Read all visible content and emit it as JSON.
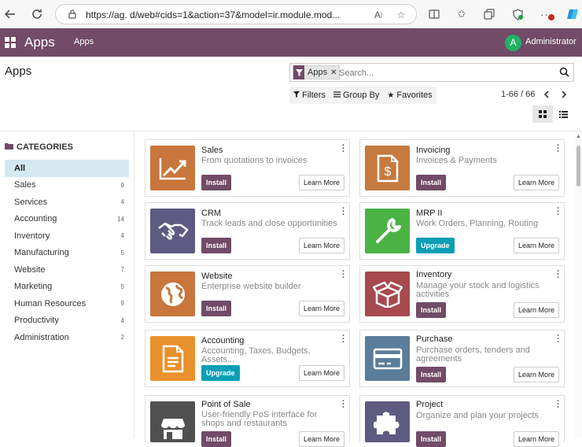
{
  "browser": {
    "url": "https://ag.          d/web#cids=1&action=37&model=ir.module.mod..."
  },
  "navbar": {
    "brand": "Apps",
    "menu_item": "Apps",
    "avatar_letter": "A",
    "user": "Administrator"
  },
  "control": {
    "title": "Apps",
    "facet_label": "Apps",
    "search_placeholder": "Search...",
    "filters": "Filters",
    "group_by": "Group By",
    "favorites": "Favorites",
    "pager": "1-66 / 66"
  },
  "sidebar": {
    "header": "CATEGORIES",
    "items": [
      {
        "label": "All",
        "count": ""
      },
      {
        "label": "Sales",
        "count": "9"
      },
      {
        "label": "Services",
        "count": "4"
      },
      {
        "label": "Accounting",
        "count": "14"
      },
      {
        "label": "Inventory",
        "count": "4"
      },
      {
        "label": "Manufacturing",
        "count": "5"
      },
      {
        "label": "Website",
        "count": "7"
      },
      {
        "label": "Marketing",
        "count": "5"
      },
      {
        "label": "Human Resources",
        "count": "9"
      },
      {
        "label": "Productivity",
        "count": "4"
      },
      {
        "label": "Administration",
        "count": "2"
      }
    ]
  },
  "apps": [
    {
      "name": "Sales",
      "summary": "From quotations to invoices",
      "action": "Install",
      "learn": "Learn More",
      "color": "#c8763b",
      "icon": "sales-chart-icon"
    },
    {
      "name": "Invoicing",
      "summary": "Invoices & Payments",
      "action": "Install",
      "learn": "Learn More",
      "color": "#c57a3f",
      "icon": "invoice-icon"
    },
    {
      "name": "CRM",
      "summary": "Track leads and close opportunities",
      "action": "Install",
      "learn": "Learn More",
      "color": "#5d5b81",
      "icon": "handshake-icon"
    },
    {
      "name": "MRP II",
      "summary": "Work Orders, Planning, Routing",
      "action": "Upgrade",
      "learn": "Learn More",
      "color": "#4bb344",
      "icon": "wrench-icon"
    },
    {
      "name": "Website",
      "summary": "Enterprise website builder",
      "action": "Install",
      "learn": "Learn More",
      "color": "#c8763b",
      "icon": "globe-icon"
    },
    {
      "name": "Inventory",
      "summary": "Manage your stock and logistics activities",
      "action": "Install",
      "learn": "Learn More",
      "color": "#a64a4f",
      "icon": "box-icon"
    },
    {
      "name": "Accounting",
      "summary": "Accounting, Taxes, Budgets, Assets...",
      "action": "Upgrade",
      "learn": "Learn More",
      "color": "#e8912d",
      "icon": "document-icon"
    },
    {
      "name": "Purchase",
      "summary": "Purchase orders, tenders and agreements",
      "action": "Install",
      "learn": "Learn More",
      "color": "#5b7d9a",
      "icon": "card-icon"
    },
    {
      "name": "Point of Sale",
      "summary": "User-friendly PoS interface for shops and restaurants",
      "action": "Install",
      "learn": "Learn More",
      "color": "#505050",
      "icon": "shop-icon"
    },
    {
      "name": "Project",
      "summary": "Organize and plan your projects",
      "action": "Install",
      "learn": "Learn More",
      "color": "#5d5b81",
      "icon": "puzzle-icon"
    }
  ]
}
